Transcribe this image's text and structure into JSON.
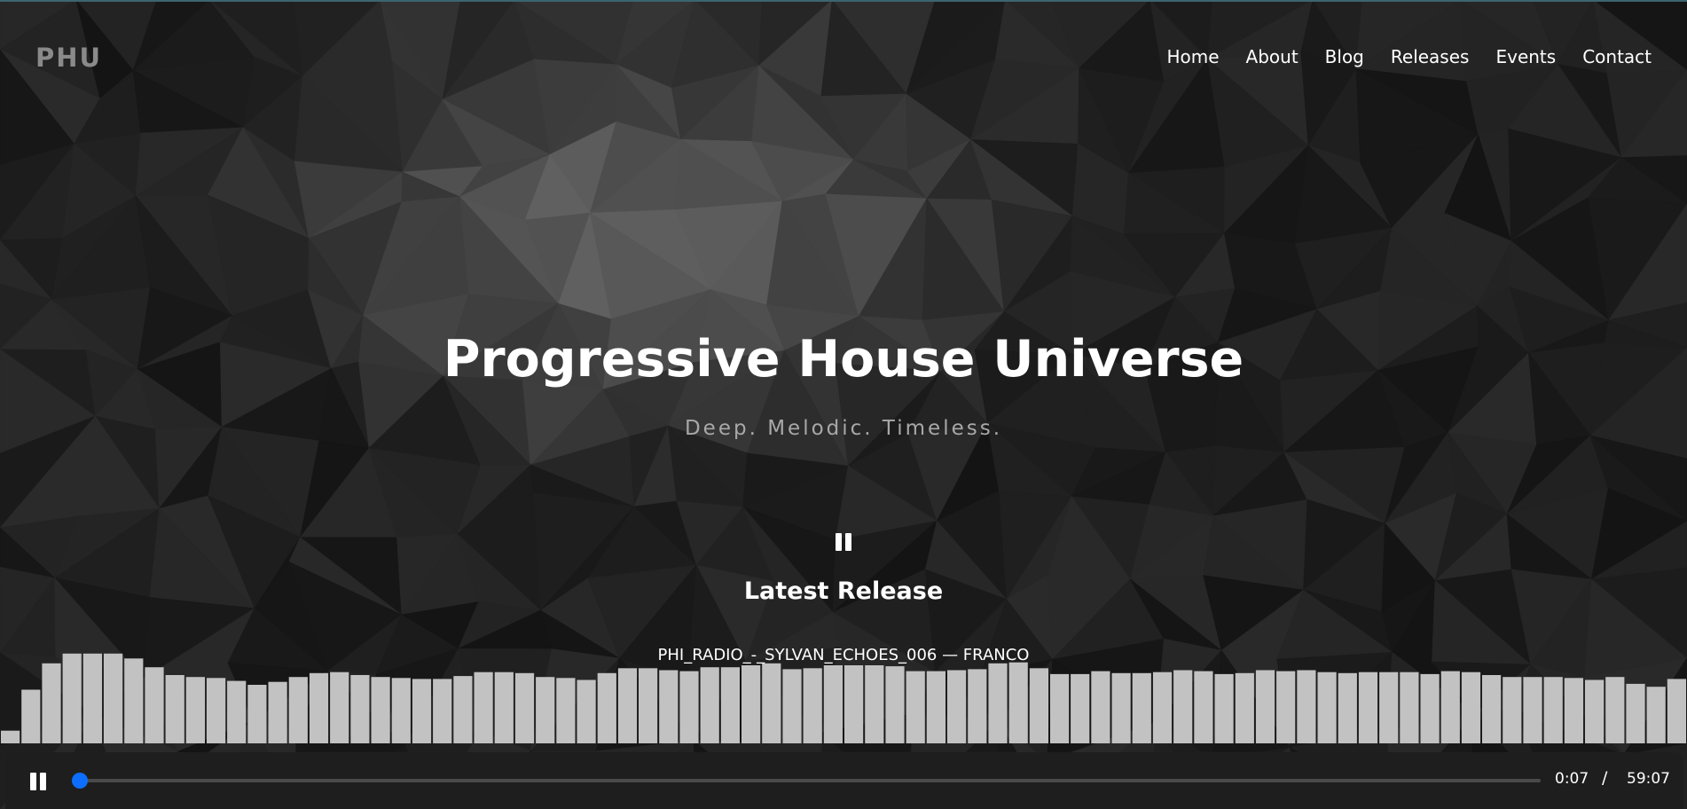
{
  "brand": "PHU",
  "nav": [
    "Home",
    "About",
    "Blog",
    "Releases",
    "Events",
    "Contact"
  ],
  "hero": {
    "title": "Progressive House Universe",
    "subtitle": "Deep. Melodic. Timeless."
  },
  "latest": {
    "heading": "Latest Release",
    "track": "PHI_RADIO_-_SYLVAN_ECHOES_006 — FRANCO"
  },
  "player": {
    "current_time": "0:07",
    "separator": "/",
    "duration": "59:07",
    "progress": 0.002
  },
  "visualizer_levels": [
    0.13,
    0.55,
    0.82,
    0.92,
    0.92,
    0.92,
    0.87,
    0.78,
    0.7,
    0.68,
    0.67,
    0.64,
    0.6,
    0.63,
    0.68,
    0.72,
    0.73,
    0.7,
    0.68,
    0.67,
    0.66,
    0.66,
    0.69,
    0.73,
    0.73,
    0.72,
    0.68,
    0.67,
    0.65,
    0.72,
    0.77,
    0.77,
    0.75,
    0.74,
    0.78,
    0.78,
    0.8,
    0.82,
    0.76,
    0.77,
    0.8,
    0.8,
    0.8,
    0.79,
    0.74,
    0.74,
    0.75,
    0.76,
    0.82,
    0.83,
    0.77,
    0.71,
    0.71,
    0.74,
    0.72,
    0.72,
    0.73,
    0.75,
    0.74,
    0.71,
    0.72,
    0.75,
    0.74,
    0.75,
    0.73,
    0.72,
    0.73,
    0.73,
    0.73,
    0.71,
    0.74,
    0.73,
    0.7,
    0.68,
    0.68,
    0.68,
    0.67,
    0.65,
    0.68,
    0.61,
    0.58,
    0.66
  ],
  "colors": {
    "accent": "#0d6efd",
    "bars": "#c2c2c2",
    "player_bg": "#1e1e1e",
    "hero_bg": "#161616"
  },
  "icons": {
    "center": "pause-icon",
    "player": "pause-icon"
  }
}
